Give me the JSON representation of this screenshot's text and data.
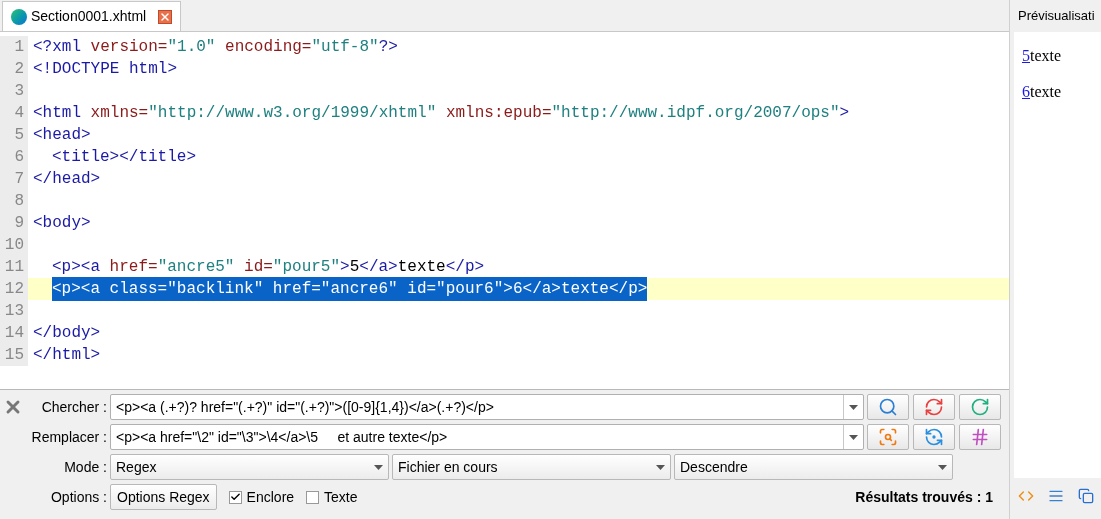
{
  "tab": {
    "title": "Section0001.xhtml",
    "selected": true
  },
  "editor": {
    "lines": [
      {
        "number": "1",
        "selected": false,
        "tokens": [
          {
            "kind": "tag",
            "text": "<?xml "
          },
          {
            "kind": "attr",
            "text": "version="
          },
          {
            "kind": "value",
            "text": "\"1.0\" "
          },
          {
            "kind": "attr",
            "text": "encoding="
          },
          {
            "kind": "value",
            "text": "\"utf-8\""
          },
          {
            "kind": "tag",
            "text": "?>"
          }
        ]
      },
      {
        "number": "2",
        "selected": false,
        "tokens": [
          {
            "kind": "tag",
            "text": "<!DOCTYPE html>"
          }
        ]
      },
      {
        "number": "3",
        "selected": false
      },
      {
        "number": "4",
        "selected": false,
        "tokens": [
          {
            "kind": "tag",
            "text": "<html "
          },
          {
            "kind": "attr",
            "text": "xmlns="
          },
          {
            "kind": "value",
            "text": "\"http://www.w3.org/1999/xhtml\" "
          },
          {
            "kind": "attr",
            "text": "xmlns:epub="
          },
          {
            "kind": "value",
            "text": "\"http://www.idpf.org/2007/ops\""
          },
          {
            "kind": "tag",
            "text": ">"
          }
        ]
      },
      {
        "number": "5",
        "selected": false,
        "tokens": [
          {
            "kind": "tag",
            "text": "<head>"
          }
        ]
      },
      {
        "number": "6",
        "selected": false,
        "indented": true,
        "tokens": [
          {
            "kind": "tag",
            "text": "<title></title>"
          }
        ]
      },
      {
        "number": "7",
        "selected": false,
        "tokens": [
          {
            "kind": "tag",
            "text": "</head>"
          }
        ]
      },
      {
        "number": "8",
        "selected": false
      },
      {
        "number": "9",
        "selected": false,
        "tokens": [
          {
            "kind": "tag",
            "text": "<body>"
          }
        ]
      },
      {
        "number": "10",
        "selected": false
      },
      {
        "number": "11",
        "selected": false,
        "indented": true,
        "tokens": [
          {
            "kind": "tag",
            "text": "<p><a "
          },
          {
            "kind": "attr",
            "text": "href="
          },
          {
            "kind": "value",
            "text": "\"ancre5\" "
          },
          {
            "kind": "attr",
            "text": "id="
          },
          {
            "kind": "value",
            "text": "\"pour5\""
          },
          {
            "kind": "tag",
            "text": ">"
          },
          {
            "kind": "text",
            "text": "5"
          },
          {
            "kind": "tag",
            "text": "</a>"
          },
          {
            "kind": "text",
            "text": "texte"
          },
          {
            "kind": "tag",
            "text": "</p>"
          }
        ]
      },
      {
        "number": "12",
        "selected": true,
        "indented": true,
        "tokens": [
          {
            "kind": "tag",
            "text": "<p><a "
          },
          {
            "kind": "attr",
            "text": "class="
          },
          {
            "kind": "value",
            "text": "\"backlink\" "
          },
          {
            "kind": "attr",
            "text": "href="
          },
          {
            "kind": "value",
            "text": "\"ancre6\" "
          },
          {
            "kind": "attr",
            "text": "id="
          },
          {
            "kind": "value",
            "text": "\"pour6\""
          },
          {
            "kind": "tag",
            "text": ">"
          },
          {
            "kind": "text",
            "text": "6"
          },
          {
            "kind": "tag",
            "text": "</a>"
          },
          {
            "kind": "text",
            "text": "texte"
          },
          {
            "kind": "tag",
            "text": "</p>"
          }
        ]
      },
      {
        "number": "13",
        "selected": false
      },
      {
        "number": "14",
        "selected": false,
        "tokens": [
          {
            "kind": "tag",
            "text": "</body>"
          }
        ]
      },
      {
        "number": "15",
        "selected": false,
        "tokens": [
          {
            "kind": "tag",
            "text": "</html>"
          }
        ]
      }
    ]
  },
  "search_panel": {
    "fields": [
      {
        "label": "Chercher :",
        "value": "<p><a (.+?)? href=\"(.+?)\" id=\"(.+?)\">([0-9]{1,4})</a>(.+?)</p>",
        "buttons": [
          {
            "kind": "search"
          },
          {
            "kind": "replace"
          },
          {
            "kind": "reset"
          }
        ]
      },
      {
        "label": "Remplacer :",
        "value": "<p><a href=\"\\2\" id=\"\\3\">\\4</a>\\5     et autre texte</p>",
        "buttons": [
          {
            "kind": "search-replace"
          },
          {
            "kind": "replace-all"
          },
          {
            "kind": "count"
          }
        ]
      }
    ],
    "mode": {
      "label": "Mode :",
      "selects": [
        "Regex",
        "Fichier en cours",
        "Descendre"
      ]
    },
    "options": {
      "label": "Options :",
      "button": "Options Regex",
      "checkboxes": [
        {
          "label": "Enclore",
          "checked": true
        },
        {
          "label": "Texte",
          "checked": false
        }
      ]
    },
    "result": "Résultats trouvés : 1"
  },
  "preview": {
    "title": "Prévisualisati",
    "paragraphs": [
      {
        "link": "5",
        "text": "texte"
      },
      {
        "link": "6",
        "text": "texte"
      }
    ]
  }
}
